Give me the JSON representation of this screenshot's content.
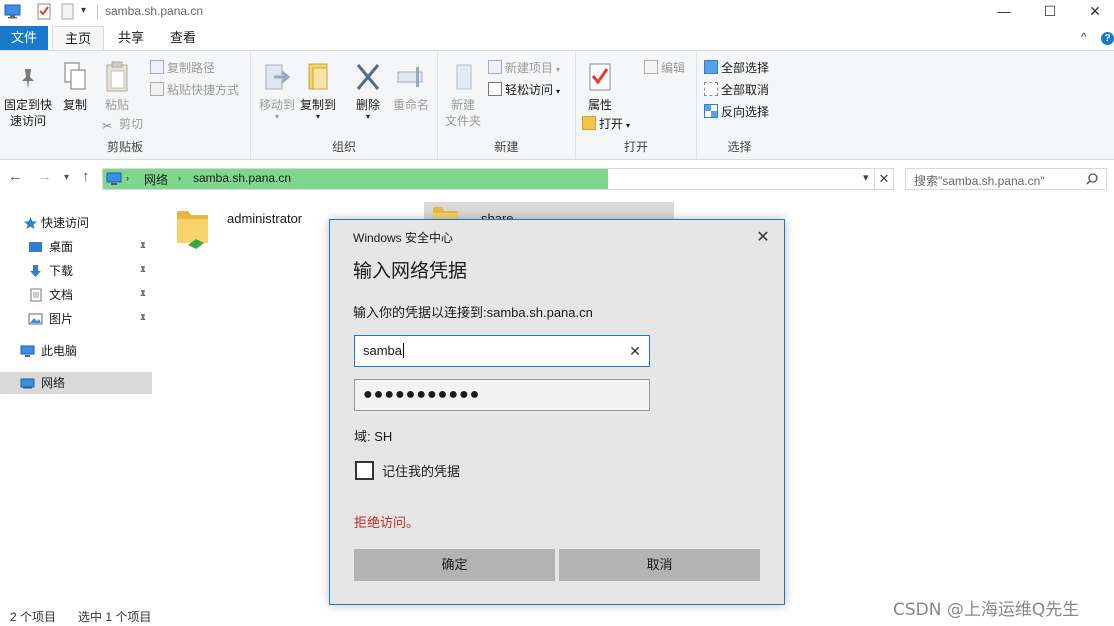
{
  "window": {
    "title": "samba.sh.pana.cn",
    "minimize": "—",
    "maximize": "☐",
    "close": "✕"
  },
  "tabs": {
    "file": "文件",
    "home": "主页",
    "share": "共享",
    "view": "查看",
    "collapse": "^",
    "help": "?"
  },
  "ribbon": {
    "clipboard": {
      "label": "剪贴板",
      "pin_quick_access": [
        "固定到快",
        "速访问"
      ],
      "copy": "复制",
      "paste": "粘贴",
      "copy_path": "复制路径",
      "paste_shortcut": "粘贴快捷方式",
      "cut": "剪切"
    },
    "organize": {
      "label": "组织",
      "move_to": "移动到",
      "copy_to": "复制到",
      "delete": "删除",
      "rename": "重命名"
    },
    "new": {
      "label": "新建",
      "new_folder": [
        "新建",
        "文件夹"
      ],
      "new_item": "新建项目",
      "easy_access": "轻松访问"
    },
    "open": {
      "label": "打开",
      "properties": "属性",
      "open": "打开",
      "edit": "编辑"
    },
    "select": {
      "label": "选择",
      "select_all": "全部选择",
      "select_none": "全部取消",
      "invert": "反向选择"
    }
  },
  "address": {
    "crumbs": [
      "网络",
      "samba.sh.pana.cn"
    ],
    "search_placeholder": "搜索\"samba.sh.pana.cn\""
  },
  "nav": {
    "items": [
      {
        "label": "快速访问"
      },
      {
        "label": "桌面"
      },
      {
        "label": "下载"
      },
      {
        "label": "文档"
      },
      {
        "label": "图片"
      },
      {
        "label": "此电脑"
      },
      {
        "label": "网络"
      }
    ]
  },
  "content": {
    "items": [
      {
        "label": "administrator"
      },
      {
        "label": "share"
      }
    ]
  },
  "status": {
    "count": "2 个项目",
    "selected": "选中 1 个项目"
  },
  "watermark": "CSDN @上海运维Q先生",
  "dialog": {
    "title": "Windows 安全中心",
    "heading": "输入网络凭据",
    "description": "输入你的凭据以连接到:samba.sh.pana.cn",
    "username": "samba",
    "password_mask": "●●●●●●●●●●●",
    "domain": "域: SH",
    "remember": "记住我的凭据",
    "error": "拒绝访问。",
    "ok": "确定",
    "cancel": "取消",
    "colors": {
      "accent": "#1979ca",
      "error": "#c42b1c",
      "address_highlight": "#7fd68d"
    }
  }
}
